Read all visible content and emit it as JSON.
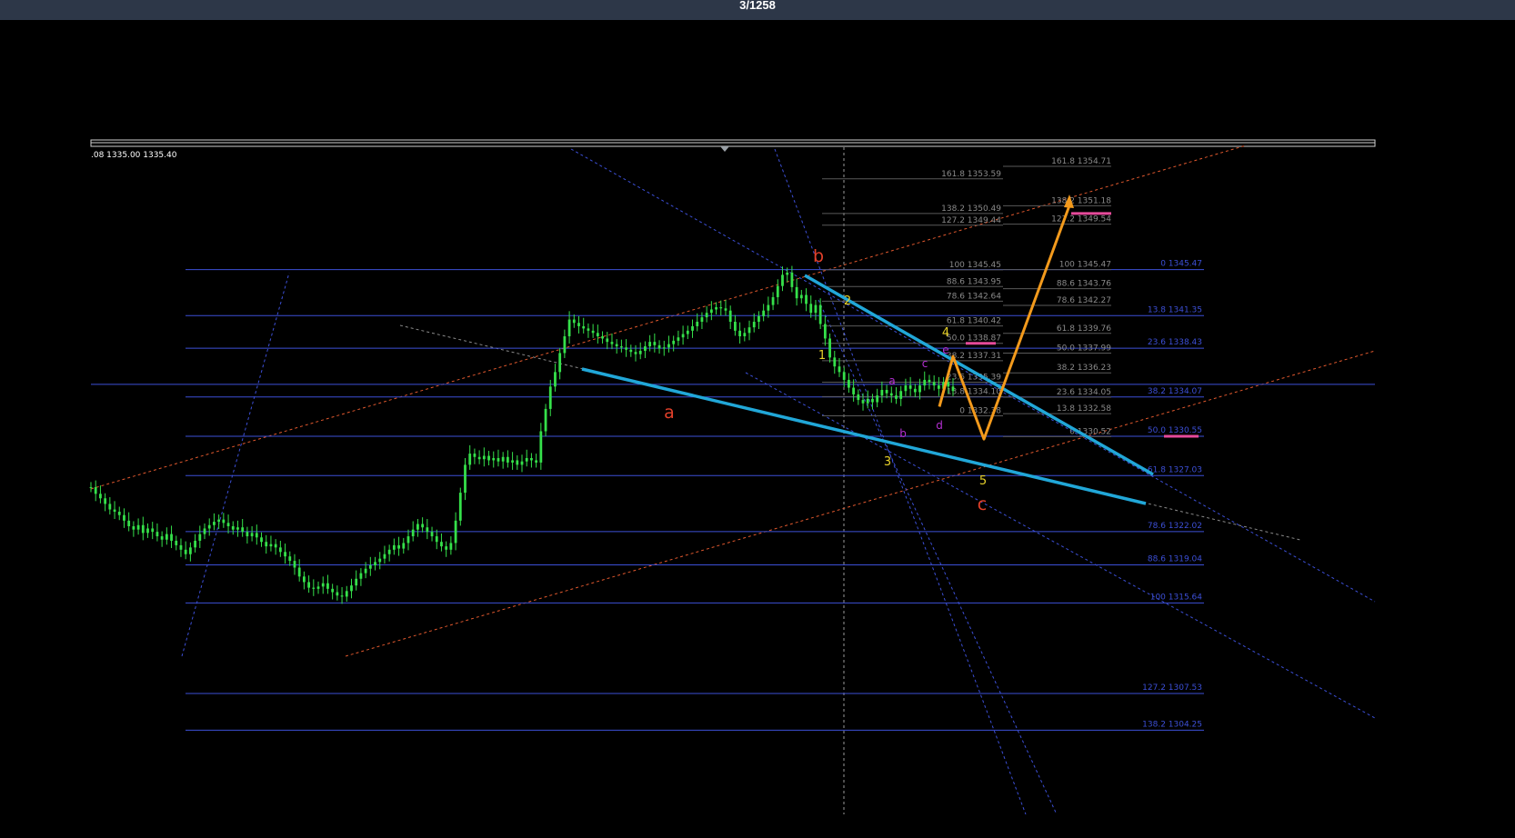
{
  "header": {
    "counter": "3/1258"
  },
  "chart_data": {
    "type": "line",
    "price_readout": ".08 1335.00 1335.40",
    "colors": {
      "background": "#000000",
      "candles": "#35e04a",
      "levels": "#3c4fd6",
      "fib_small": "#8a8a8a",
      "trend_cyan": "#21a7d8",
      "projection": "#f39a1c",
      "channel": "#e0582e",
      "wave_red": "#e2402a",
      "wave_yellow": "#e8d22a",
      "wave_magenta": "#b52fd3",
      "pink_marker": "#e64a9a"
    },
    "ylim": [
      1300.0,
      1357.0
    ],
    "price_series": [
      1326.0,
      1325.4,
      1325.0,
      1324.5,
      1324.0,
      1323.8,
      1323.5,
      1323.0,
      1322.5,
      1322.2,
      1322.6,
      1321.9,
      1322.3,
      1322.0,
      1321.6,
      1321.3,
      1321.8,
      1321.2,
      1320.8,
      1320.4,
      1320.0,
      1320.6,
      1321.2,
      1321.8,
      1322.3,
      1322.6,
      1322.9,
      1323.1,
      1322.8,
      1322.5,
      1322.2,
      1322.4,
      1322.0,
      1321.6,
      1321.9,
      1321.5,
      1321.1,
      1320.7,
      1320.9,
      1320.6,
      1320.2,
      1319.8,
      1319.4,
      1318.8,
      1318.0,
      1317.5,
      1317.0,
      1316.9,
      1317.1,
      1317.4,
      1316.9,
      1316.6,
      1316.3,
      1316.2,
      1316.7,
      1317.2,
      1317.8,
      1318.3,
      1318.7,
      1319.0,
      1319.3,
      1319.6,
      1320.0,
      1320.4,
      1320.8,
      1320.5,
      1321.0,
      1321.6,
      1322.2,
      1322.7,
      1322.4,
      1322.0,
      1321.6,
      1321.1,
      1320.7,
      1320.4,
      1321.0,
      1323.0,
      1325.5,
      1328.0,
      1329.0,
      1328.7,
      1328.5,
      1328.8,
      1328.4,
      1328.6,
      1328.3,
      1328.7,
      1328.2,
      1328.4,
      1328.0,
      1328.3,
      1328.6,
      1328.4,
      1328.2,
      1331.0,
      1333.0,
      1335.0,
      1336.3,
      1338.0,
      1339.5,
      1341.0,
      1340.7,
      1340.4,
      1340.2,
      1340.0,
      1339.8,
      1339.5,
      1339.3,
      1339.0,
      1338.8,
      1338.6,
      1338.5,
      1338.3,
      1338.1,
      1337.9,
      1338.2,
      1338.6,
      1339.0,
      1338.7,
      1338.4,
      1338.5,
      1338.8,
      1339.1,
      1339.4,
      1339.7,
      1340.0,
      1340.4,
      1340.8,
      1341.2,
      1341.6,
      1341.9,
      1342.1,
      1342.0,
      1341.8,
      1340.8,
      1340.0,
      1339.5,
      1339.8,
      1340.3,
      1340.8,
      1341.3,
      1341.8,
      1342.3,
      1343.0,
      1344.0,
      1345.0,
      1345.2,
      1343.9,
      1342.9,
      1343.2,
      1342.4,
      1341.6,
      1342.3,
      1340.6,
      1339.3,
      1337.6,
      1336.8,
      1336.3,
      1335.6,
      1334.9,
      1334.3,
      1333.8,
      1333.5,
      1333.9,
      1333.6,
      1334.2,
      1334.7,
      1334.4,
      1334.2,
      1333.9,
      1334.6,
      1335.1,
      1334.8,
      1334.5,
      1335.1,
      1335.6,
      1335.4,
      1335.1,
      1334.8,
      1335.4,
      1335.0,
      1334.6
    ],
    "horizontal_levels": [
      {
        "ratio": "100",
        "value": 1345.47,
        "label": "0 1345.47"
      },
      {
        "ratio": "13.8",
        "value": 1341.35,
        "label": "13.8 1341.35"
      },
      {
        "ratio": "23.6",
        "value": 1338.43,
        "label": "23.6 1338.43"
      },
      {
        "ratio": "38.2",
        "value": 1334.07,
        "label": "38.2 1334.07"
      },
      {
        "ratio": "50.0",
        "value": 1330.55,
        "label": "50.0 1330.55"
      },
      {
        "ratio": "61.8",
        "value": 1327.03,
        "label": "61.8 1327.03"
      },
      {
        "ratio": "78.6",
        "value": 1322.02,
        "label": "78.6 1322.02"
      },
      {
        "ratio": "88.6",
        "value": 1319.04,
        "label": "88.6 1319.04"
      },
      {
        "ratio": "100",
        "value": 1315.64,
        "label": "100 1315.64"
      },
      {
        "ratio": "127.2",
        "value": 1307.53,
        "label": "127.2 1307.53"
      },
      {
        "ratio": "138.2",
        "value": 1304.25,
        "label": "138.2 1304.25"
      }
    ],
    "fib_set_1": [
      {
        "value": 1353.59,
        "label": "161.8 1353.59"
      },
      {
        "value": 1350.49,
        "label": "138.2 1350.49"
      },
      {
        "value": 1349.44,
        "label": "127.2 1349.44"
      },
      {
        "value": 1345.45,
        "label": "100 1345.45"
      },
      {
        "value": 1343.95,
        "label": "88.6 1343.95"
      },
      {
        "value": 1342.64,
        "label": "78.6 1342.64"
      },
      {
        "value": 1340.42,
        "label": "61.8 1340.42"
      },
      {
        "value": 1338.87,
        "label": "50.0 1338.87"
      },
      {
        "value": 1337.31,
        "label": "38.2 1337.31"
      },
      {
        "value": 1335.39,
        "label": "23.6 1335.39"
      },
      {
        "value": 1334.1,
        "label": "13.8 1334.10"
      },
      {
        "value": 1332.38,
        "label": "0 1332.38"
      }
    ],
    "fib_set_2": [
      {
        "value": 1354.71,
        "label": "161.8 1354.71"
      },
      {
        "value": 1351.18,
        "label": "138.2 1351.18"
      },
      {
        "value": 1349.54,
        "label": "127.2 1349.54"
      },
      {
        "value": 1345.47,
        "label": "100 1345.47"
      },
      {
        "value": 1343.76,
        "label": "88.6 1343.76"
      },
      {
        "value": 1342.27,
        "label": "78.6 1342.27"
      },
      {
        "value": 1339.76,
        "label": "61.8 1339.76"
      },
      {
        "value": 1337.99,
        "label": "50.0 1337.99"
      },
      {
        "value": 1336.23,
        "label": "38.2 1336.23"
      },
      {
        "value": 1334.05,
        "label": "23.6 1334.05"
      },
      {
        "value": 1332.58,
        "label": "13.8 1332.58"
      },
      {
        "value": 1330.52,
        "label": "0 1330.52"
      }
    ],
    "wave_labels": {
      "red": [
        "a",
        "b",
        "c"
      ],
      "yellow": [
        "1",
        "2",
        "3",
        "4",
        "5"
      ],
      "magenta": [
        "a",
        "b",
        "c",
        "d",
        "e"
      ]
    },
    "projection_path_prices": [
      1333.2,
      1337.7,
      1330.3,
      1351.2
    ]
  }
}
